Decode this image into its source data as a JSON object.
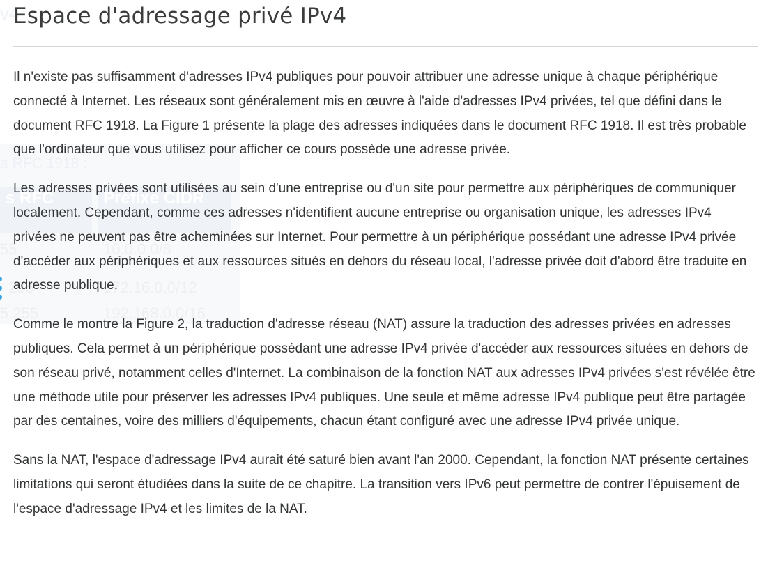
{
  "page": {
    "title": "Espace d'adressage privé IPv4"
  },
  "paragraphs": [
    "Il n'existe pas suffisamment d'adresses IPv4 publiques pour pouvoir attribuer une adresse unique à chaque périphérique connecté à Internet. Les réseaux sont généralement mis en œuvre à l'aide d'adresses IPv4 privées, tel que défini dans le document RFC 1918. La Figure 1 présente la plage des adresses indiquées dans le document RFC 1918. Il est très probable que l'ordinateur que vous utilisez pour afficher ce cours possède une adresse privée.",
    "Les adresses privées sont utilisées au sein d'une entreprise ou d'un site pour permettre aux périphériques de communiquer localement. Cependant, comme ces adresses n'identifient aucune entreprise ou organisation unique, les adresses IPv4 privées ne peuvent pas être acheminées sur Internet. Pour permettre à un périphérique possédant une adresse IPv4 privée d'accéder aux périphériques et aux ressources situés en dehors du réseau local, l'adresse privée doit d'abord être traduite en adresse publique.",
    "Comme le montre la Figure 2, la traduction d'adresse réseau (NAT) assure la traduction des adresses privées en adresses publiques. Cela permet à un périphérique possédant une adresse IPv4 privée d'accéder aux ressources situées en dehors de son réseau privé, notamment celles d'Internet. La combinaison de la fonction NAT aux adresses IPv4 privées s'est révélée être une méthode utile pour préserver les adresses IPv4 publiques. Une seule et même adresse IPv4 publique peut être partagée par des centaines, voire des milliers d'équipements, chacun étant configuré avec une adresse IPv4 privée unique.",
    "Sans la NAT, l'espace d'adressage IPv4 aurait été saturé bien avant l'an 2000. Cependant, la fonction NAT présente certaines limitations qui seront étudiées dans la suite de ce chapitre. La transition vers IPv6 peut permettre de contrer l'épuisement de l'espace d'adressage IPv4 et les limites de la NAT."
  ],
  "ghost_figure": {
    "corner_text": "v4",
    "caption": "a RFC 1918 :",
    "col1_header": "s RFC",
    "col2_header": "Préfixe CIDR",
    "rows": [
      [
        "55",
        "10.0.0.0/8"
      ],
      [
        "255",
        "172.16.0.0/12"
      ],
      [
        "5.255",
        "192.168.0.0/16"
      ]
    ]
  }
}
